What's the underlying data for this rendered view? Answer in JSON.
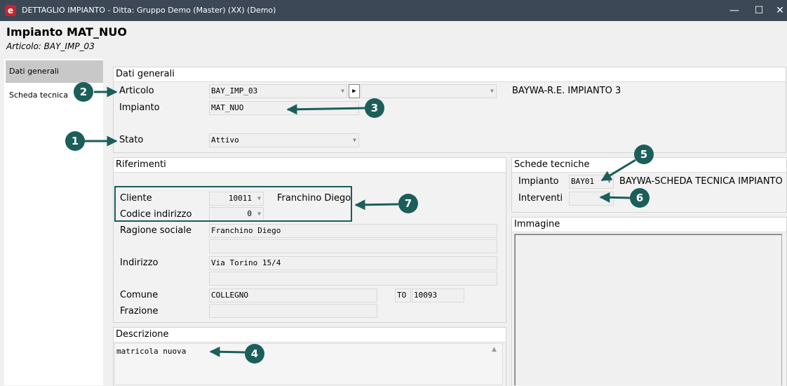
{
  "window": {
    "title": "DETTAGLIO IMPIANTO - Ditta: Gruppo Demo (Master) (XX)  (Demo)",
    "app_icon": "e",
    "minimize": "—",
    "maximize": "☐",
    "close": "✕"
  },
  "header": {
    "title": "Impianto MAT_NUO",
    "subtitle": "Articolo: BAY_IMP_03"
  },
  "menu": {
    "items": [
      {
        "label": "Dati generali",
        "active": true
      },
      {
        "label": "Scheda tecnica",
        "active": false
      }
    ]
  },
  "dati_generali": {
    "title": "Dati generali",
    "articolo_label": "Articolo",
    "articolo_value": "BAY_IMP_03",
    "articolo_desc": "BAYWA-R.E. IMPIANTO 3",
    "impianto_label": "Impianto",
    "impianto_value": "MAT_NUO",
    "stato_label": "Stato",
    "stato_value": "Attivo"
  },
  "riferimenti": {
    "title": "Riferimenti",
    "cliente_label": "Cliente",
    "cliente_value": "10011",
    "cliente_name": "Franchino Diego",
    "codind_label": "Codice indirizzo",
    "codind_value": "0",
    "ragione_label": "Ragione sociale",
    "ragione_value": "Franchino Diego",
    "ragione_value2": "",
    "indirizzo_label": "Indirizzo",
    "indirizzo_value": "Via Torino 15/4",
    "indirizzo_value2": "",
    "comune_label": "Comune",
    "comune_value": "COLLEGNO",
    "provincia_value": "TO",
    "cap_value": "10093",
    "frazione_label": "Frazione",
    "frazione_value": ""
  },
  "descrizione": {
    "title": "Descrizione",
    "value": "matricola nuova"
  },
  "schede_tecniche": {
    "title": "Schede tecniche",
    "impianto_label": "Impianto",
    "impianto_value": "BAY01",
    "impianto_desc": "BAYWA-SCHEDA TECNICA IMPIANTO",
    "interventi_label": "Interventi",
    "interventi_value": ""
  },
  "immagine": {
    "title": "Immagine"
  },
  "callouts": [
    "1",
    "2",
    "3",
    "4",
    "5",
    "6",
    "7"
  ],
  "colors": {
    "callout": "#1b5e5a",
    "titlebar": "#3c4856"
  }
}
